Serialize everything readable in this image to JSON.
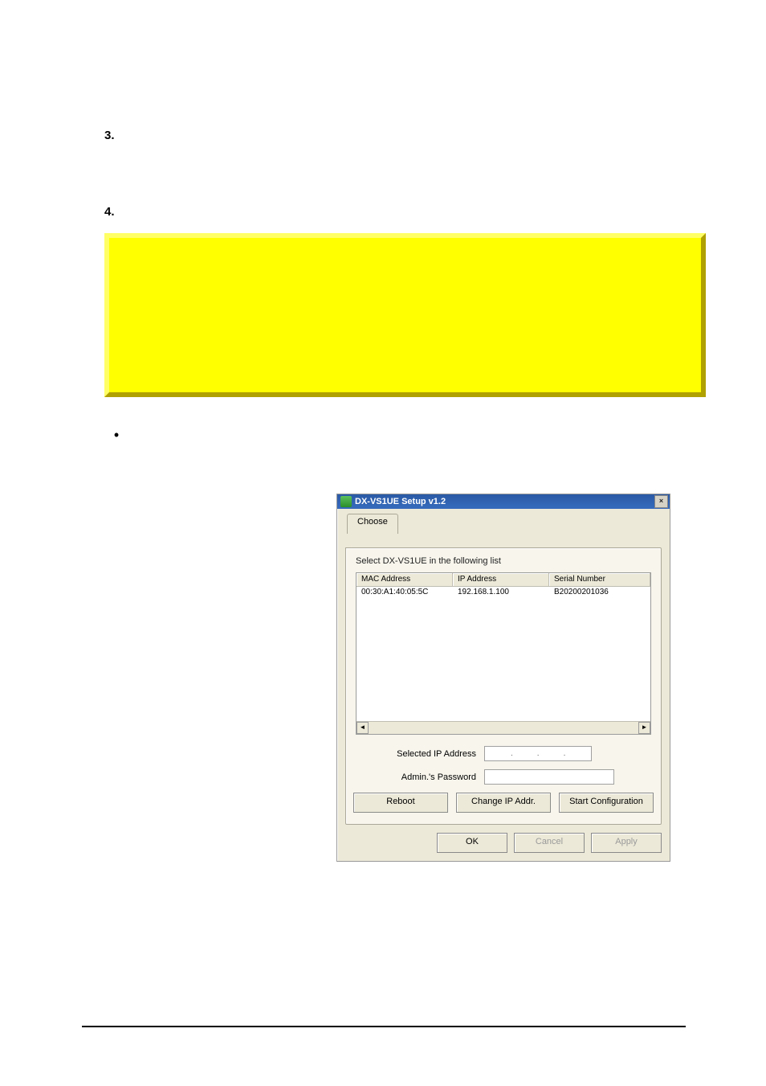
{
  "list": {
    "item3": {
      "num": "3."
    },
    "item4": {
      "num": "4."
    }
  },
  "bullet": {
    "glyph": "•"
  },
  "dialog": {
    "title": "DX-VS1UE  Setup v1.2",
    "close_glyph": "×",
    "tab": "Choose",
    "caption": "Select  DX-VS1UE  in the following list",
    "columns": {
      "mac": "MAC Address",
      "ip": "IP Address",
      "sn": "Serial Number"
    },
    "rows": [
      {
        "mac": "00:30:A1:40:05:5C",
        "ip": "192.168.1.100",
        "sn": "B20200201036"
      }
    ],
    "form": {
      "ip_label": "Selected IP Address",
      "pw_label": "Admin.'s Password"
    },
    "buttons": {
      "reboot": "Reboot",
      "change_ip": "Change IP Addr.",
      "start_cfg": "Start Configuration",
      "ok": "OK",
      "cancel": "Cancel",
      "apply": "Apply"
    },
    "scroll": {
      "left": "◄",
      "right": "►"
    }
  }
}
